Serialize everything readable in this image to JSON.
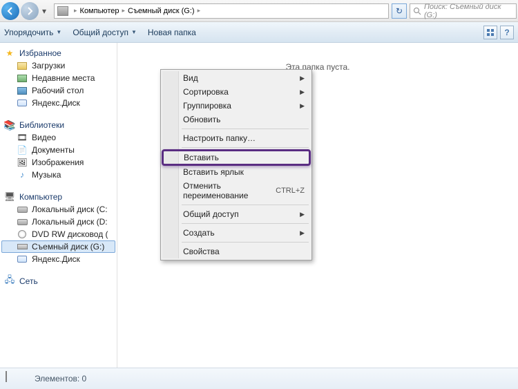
{
  "nav": {
    "breadcrumb": [
      "Компьютер",
      "Съемный диск (G:)"
    ],
    "search_placeholder": "Поиск: Съемный диск (G:)"
  },
  "toolbar": {
    "organize": "Упорядочить",
    "share": "Общий доступ",
    "new_folder": "Новая папка"
  },
  "sidebar": {
    "favorites": {
      "label": "Избранное",
      "items": [
        "Загрузки",
        "Недавние места",
        "Рабочий стол",
        "Яндекс.Диск"
      ]
    },
    "libraries": {
      "label": "Библиотеки",
      "items": [
        "Видео",
        "Документы",
        "Изображения",
        "Музыка"
      ]
    },
    "computer": {
      "label": "Компьютер",
      "items": [
        "Локальный диск (С:",
        "Локальный диск (D:",
        "DVD RW дисковод (",
        "Съемный диск (G:)",
        "Яндекс.Диск"
      ]
    },
    "network": {
      "label": "Сеть"
    }
  },
  "content": {
    "empty": "Эта папка пуста."
  },
  "context_menu": {
    "view": "Вид",
    "sort": "Сортировка",
    "group": "Группировка",
    "refresh": "Обновить",
    "customize": "Настроить папку…",
    "paste": "Вставить",
    "paste_shortcut": "Вставить ярлык",
    "undo_rename": "Отменить переименование",
    "undo_shortcut": "CTRL+Z",
    "share": "Общий доступ",
    "new": "Создать",
    "properties": "Свойства"
  },
  "status": {
    "items": "Элементов: 0"
  }
}
